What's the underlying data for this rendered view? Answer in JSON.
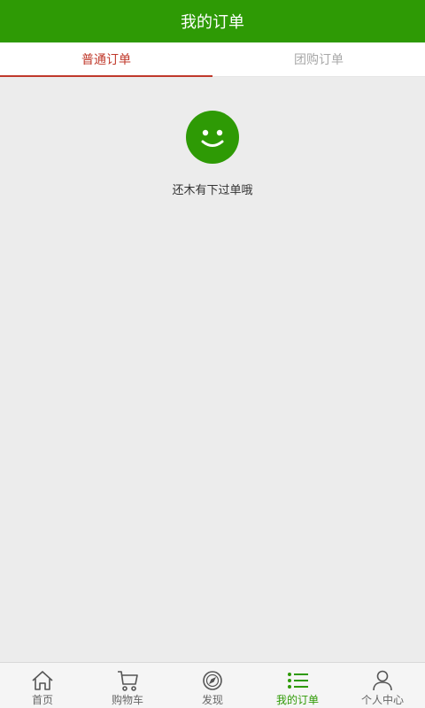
{
  "header": {
    "title": "我的订单"
  },
  "tabs": [
    {
      "label": "普通订单",
      "active": true
    },
    {
      "label": "团购订单",
      "active": false
    }
  ],
  "empty_state": {
    "icon": "smiley-icon",
    "message": "还木有下过单哦"
  },
  "bottom_nav": [
    {
      "label": "首页",
      "icon": "home-icon",
      "active": false
    },
    {
      "label": "购物车",
      "icon": "cart-icon",
      "active": false
    },
    {
      "label": "发现",
      "icon": "compass-icon",
      "active": false
    },
    {
      "label": "我的订单",
      "icon": "list-icon",
      "active": true
    },
    {
      "label": "个人中心",
      "icon": "user-icon",
      "active": false
    }
  ],
  "colors": {
    "brand_green": "#2e9a05",
    "active_tab_red": "#c0392b",
    "background": "#ececec"
  }
}
